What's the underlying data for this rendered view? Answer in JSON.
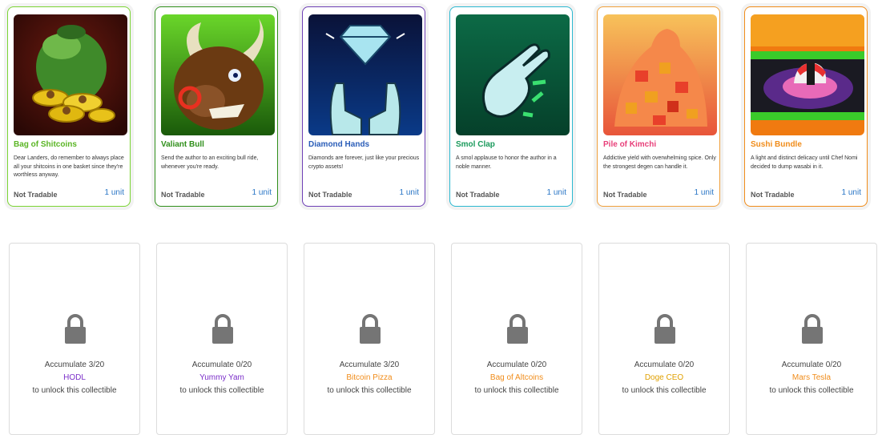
{
  "collectibles": [
    {
      "title": "Bag of Shitcoins",
      "desc": "Dear Landers, do remember to always place all your shitcoins in one basket since they're worthless anyway.",
      "status": "Not Tradable",
      "units": "1 unit",
      "color": "#5ab524",
      "border": "#7bd433"
    },
    {
      "title": "Valiant Bull",
      "desc": "Send the author to an exciting bull ride, whenever you're ready.",
      "status": "Not Tradable",
      "units": "1 unit",
      "color": "#2f8f1a",
      "border": "#2f8f1a"
    },
    {
      "title": "Diamond Hands",
      "desc": "Diamonds are forever, just like your precious crypto assets!",
      "status": "Not Tradable",
      "units": "1 unit",
      "color": "#2a5db8",
      "border": "#6d3fb5"
    },
    {
      "title": "Smol Clap",
      "desc": "A smol applause to honor the author in a noble manner.",
      "status": "Not Tradable",
      "units": "1 unit",
      "color": "#1a9a5c",
      "border": "#2ab8d0"
    },
    {
      "title": "Pile of Kimchi",
      "desc": "Addictive yield with overwhelming spice. Only the strongest degen can handle it.",
      "status": "Not Tradable",
      "units": "1 unit",
      "color": "#e8407a",
      "border": "#f0a03c"
    },
    {
      "title": "Sushi Bundle",
      "desc": "A light and distinct delicacy until Chef Nomi decided to dump wasabi in it.",
      "status": "Not Tradable",
      "units": "1 unit",
      "color": "#f08c1a",
      "border": "#f08c1a"
    }
  ],
  "locked": [
    {
      "progress": "Accumulate 3/20",
      "name": "HODL",
      "suffix": "to unlock this collectible",
      "color": "#7b2fc9"
    },
    {
      "progress": "Accumulate 0/20",
      "name": "Yummy Yam",
      "suffix": "to unlock this collectible",
      "color": "#7b2fc9"
    },
    {
      "progress": "Accumulate 3/20",
      "name": "Bitcoin Pizza",
      "suffix": "to unlock this collectible",
      "color": "#f08c1a"
    },
    {
      "progress": "Accumulate 0/20",
      "name": "Bag of Altcoins",
      "suffix": "to unlock this collectible",
      "color": "#f08c1a"
    },
    {
      "progress": "Accumulate 0/20",
      "name": "Doge CEO",
      "suffix": "to unlock this collectible",
      "color": "#e0a000"
    },
    {
      "progress": "Accumulate 0/20",
      "name": "Mars Tesla",
      "suffix": "to unlock this collectible",
      "color": "#f08c1a"
    }
  ]
}
